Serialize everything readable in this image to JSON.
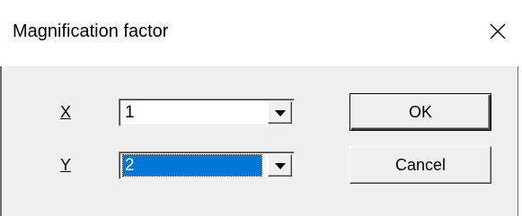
{
  "window": {
    "title": "Magnification factor"
  },
  "fields": {
    "x": {
      "label_prefix": "",
      "label_accel": "X",
      "value": "1"
    },
    "y": {
      "label_prefix": "",
      "label_accel": "Y",
      "value": "2"
    }
  },
  "buttons": {
    "ok": "OK",
    "cancel": "Cancel"
  },
  "icons": {
    "close": "close-icon",
    "dropdown": "chevron-down-icon"
  },
  "colors": {
    "selection": "#0078d7",
    "dialog_bg": "#f0f0f0"
  }
}
